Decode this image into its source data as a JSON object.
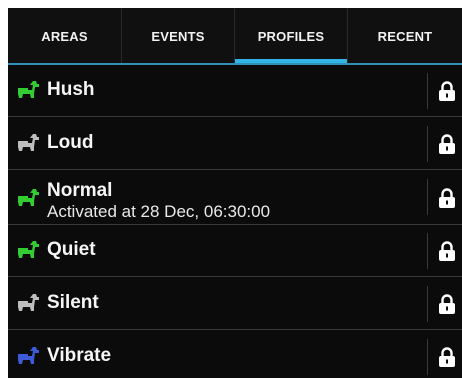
{
  "tabs": [
    {
      "label": "AREAS",
      "selected": false
    },
    {
      "label": "EVENTS",
      "selected": false
    },
    {
      "label": "PROFILES",
      "selected": true
    },
    {
      "label": "RECENT",
      "selected": false
    }
  ],
  "colors": {
    "accent": "#33b5e5",
    "green": "#33cc33",
    "gray": "#bdbdbd",
    "blue": "#3d5bd9"
  },
  "profiles": [
    {
      "name": "Hush",
      "status": "",
      "icon": "green-animal-icon",
      "locked": true
    },
    {
      "name": "Loud",
      "status": "",
      "icon": "gray-animal-icon",
      "locked": true
    },
    {
      "name": "Normal",
      "status": "Activated at 28 Dec, 06:30:00",
      "icon": "green-animal-icon",
      "locked": true
    },
    {
      "name": "Quiet",
      "status": "",
      "icon": "green-animal-icon",
      "locked": true
    },
    {
      "name": "Silent",
      "status": "",
      "icon": "gray-animal-icon",
      "locked": true
    },
    {
      "name": "Vibrate",
      "status": "",
      "icon": "blue-animal-icon",
      "locked": true
    }
  ]
}
